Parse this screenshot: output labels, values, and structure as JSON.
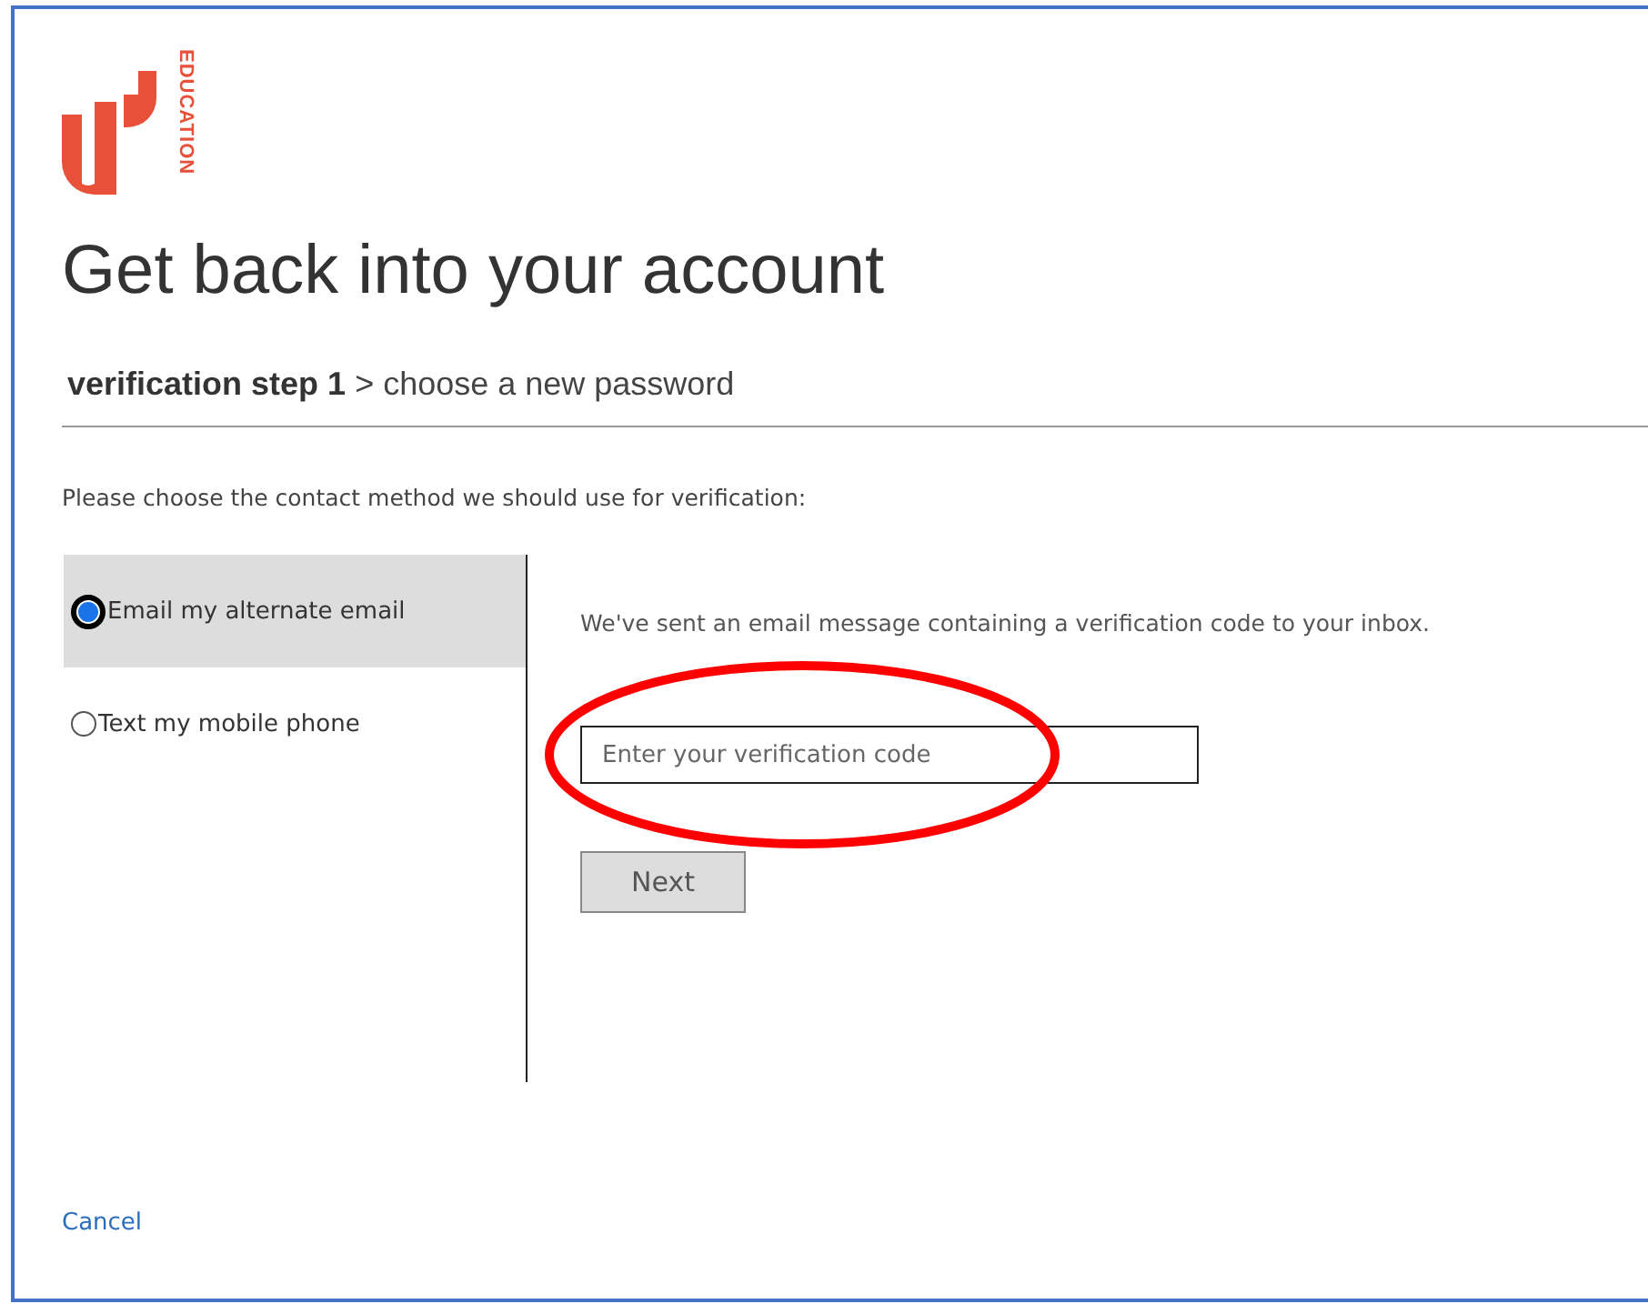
{
  "logo": {
    "word": "EDUCATION"
  },
  "title": "Get back into your account",
  "steps": "**verification step 1** > choose a new password",
  "instruction": "Please choose the contact method we should use for verification:",
  "methods": [
    {
      "label": "Email my alternate email",
      "selected": true
    },
    {
      "label": "Text my mobile phone",
      "selected": false
    }
  ],
  "message": "We've sent an email message containing a verification code to your inbox.",
  "code_field": {
    "placeholder": "Enter your verification code"
  },
  "next_button": "Next",
  "cancel_link": "Cancel"
}
